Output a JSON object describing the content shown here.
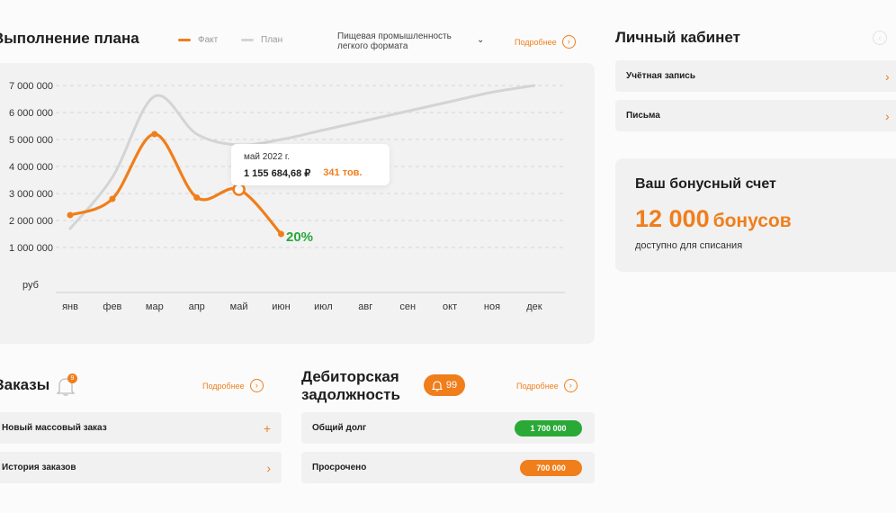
{
  "plan": {
    "title": "Выполнение плана",
    "legend": [
      {
        "label": "Факт",
        "color": "#f07e1b"
      },
      {
        "label": "План",
        "color": "#d4d4d4"
      }
    ],
    "filter_label": "Пищевая промышленность легкого формата",
    "more_label": "Подробнее",
    "tooltip": {
      "date": "май 2022 г.",
      "amount": "1 155 684,68 ₽",
      "goods": "341 тов."
    },
    "percent": "20%"
  },
  "chart_data": {
    "type": "line",
    "categories": [
      "янв",
      "фев",
      "мар",
      "апр",
      "май",
      "июн",
      "июл",
      "авг",
      "сен",
      "окт",
      "ноя",
      "дек"
    ],
    "y_ticks": [
      "7 000 000",
      "6 000 000",
      "5 000 000",
      "4 000 000",
      "3 000 000",
      "2 000 000",
      "1 000 000"
    ],
    "y_unit": "руб",
    "ylim": [
      0,
      7000000
    ],
    "grid": true,
    "series": [
      {
        "name": "Факт",
        "color": "#f07e1b",
        "values": [
          2200000,
          2800000,
          5200000,
          2850000,
          3150000,
          1500000
        ]
      },
      {
        "name": "План",
        "color": "#d4d4d4",
        "values": [
          1700000,
          3600000,
          6600000,
          5200000,
          4800000,
          5000000,
          5350000,
          5700000,
          6050000,
          6400000,
          6750000,
          7000000
        ]
      }
    ]
  },
  "orders": {
    "title": "Заказы",
    "badge": "9",
    "more_label": "Подробнее",
    "items": [
      {
        "label": "Новый массовый заказ",
        "icon": "+"
      },
      {
        "label": "История заказов",
        "icon": "›"
      }
    ]
  },
  "debt": {
    "title_line1": "Дебиторская",
    "title_line2": "задолжность",
    "badge": "99",
    "more_label": "Подробнее",
    "rows": [
      {
        "label": "Общий долг",
        "value": "1 700 000",
        "color": "#2aa937"
      },
      {
        "label": "Просрочено",
        "value": "700 000",
        "color": "#f07e1b"
      }
    ]
  },
  "cabinet": {
    "title": "Личный кабинет",
    "items": [
      {
        "label": "Учётная запись"
      },
      {
        "label": "Письма"
      }
    ]
  },
  "bonus": {
    "title": "Ваш бонусный счет",
    "amount": "12 000",
    "unit": "бонусов",
    "subtitle": "доступно для списания"
  }
}
